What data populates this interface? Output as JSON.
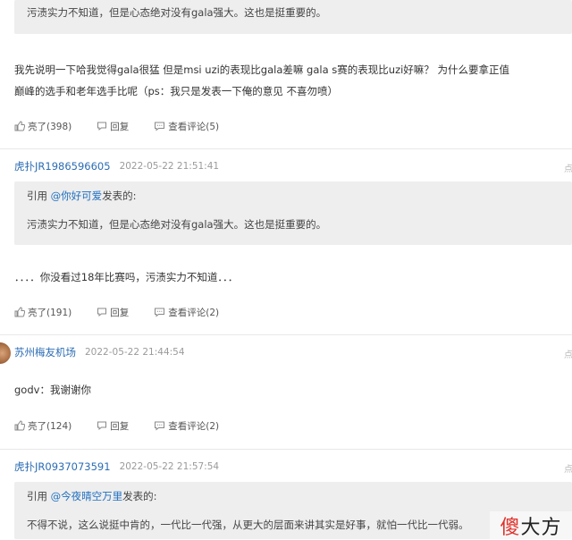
{
  "quote0": {
    "text": "污渍实力不知道，但是心态绝对没有gala强大。这也是挺重要的。"
  },
  "post0": {
    "lines": [
      "我先说明一下哈我觉得gala很猛 但是msi uzi的表现比gala差嘛 gala s赛的表现比uzi好嘛？ 为什么要拿正值",
      "巅峰的选手和老年选手比呢（ps：我只是发表一下俺的意见 不喜勿喷）"
    ],
    "likes": "亮了(398)",
    "reply": "回复",
    "comments": "查看评论(5)"
  },
  "post1": {
    "user": "虎扑JR1986596605",
    "time": "2022-05-22 21:51:41",
    "edge": "点",
    "quote_prefix": "引用",
    "quote_user": "@你好可爱",
    "quote_suffix": "发表的:",
    "quote_text": "污渍实力不知道，但是心态绝对没有gala强大。这也是挺重要的。",
    "body": "．．．．你没看过18年比赛吗，污渍实力不知道．．．",
    "likes": "亮了(191)",
    "reply": "回复",
    "comments": "查看评论(2)"
  },
  "post2": {
    "user": "苏州梅友机场",
    "time": "2022-05-22 21:44:54",
    "edge": "点",
    "body": "godv：我谢谢你",
    "likes": "亮了(124)",
    "reply": "回复",
    "comments": "查看评论(2)"
  },
  "post3": {
    "user": "虎扑JR0937073591",
    "time": "2022-05-22 21:57:54",
    "edge": "点",
    "quote_prefix": "引用",
    "quote_user": "@今夜晴空万里",
    "quote_suffix": "发表的:",
    "quote_text": "不得不说，这么说挺中肯的，一代比一代强，从更大的层面来讲其实是好事，就怕一代比一代弱。"
  },
  "watermark": {
    "first": "傻",
    "rest": "大方"
  }
}
